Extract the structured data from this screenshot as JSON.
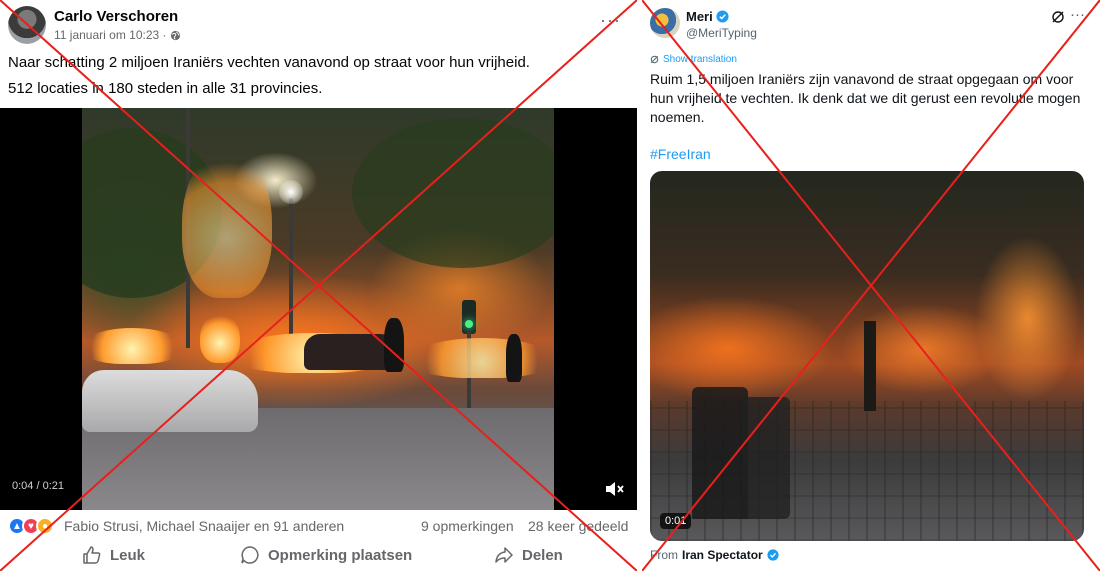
{
  "facebook_post": {
    "author": "Carlo Verschoren",
    "timestamp": "11 januari om 10:23 ·",
    "more_label": "···",
    "text_line1": "Naar schatting 2 miljoen Iraniërs vechten vanavond op straat voor hun vrijheid.",
    "text_line2": "512 locaties in 180 steden in alle 31 provincies.",
    "video_time": "0:04 / 0:21",
    "reactions_text": "Fabio Strusi, Michael Snaaijer en 91 anderen",
    "comments": "9 opmerkingen",
    "shares": "28 keer gedeeld",
    "actions": {
      "like": "Leuk",
      "comment": "Opmerking plaatsen",
      "share": "Delen"
    }
  },
  "x_post": {
    "name": "Meri",
    "handle": "@MeriTyping",
    "more_label": "···",
    "translation_label": "Show translation",
    "text": "Ruim 1,5 miljoen Iraniërs zijn vanavond de straat opgegaan om voor hun vrijheid te vechten. Ik denk dat we dit gerust een revolutie mogen noemen.",
    "hashtag": "#FreeIran",
    "video_duration": "0:01",
    "from_prefix": "From",
    "from_source": "Iran Spectator"
  },
  "colors": {
    "x_accent": "#1d9bf0",
    "fb_blue": "#1877f2",
    "cross_red": "#e8201c"
  }
}
